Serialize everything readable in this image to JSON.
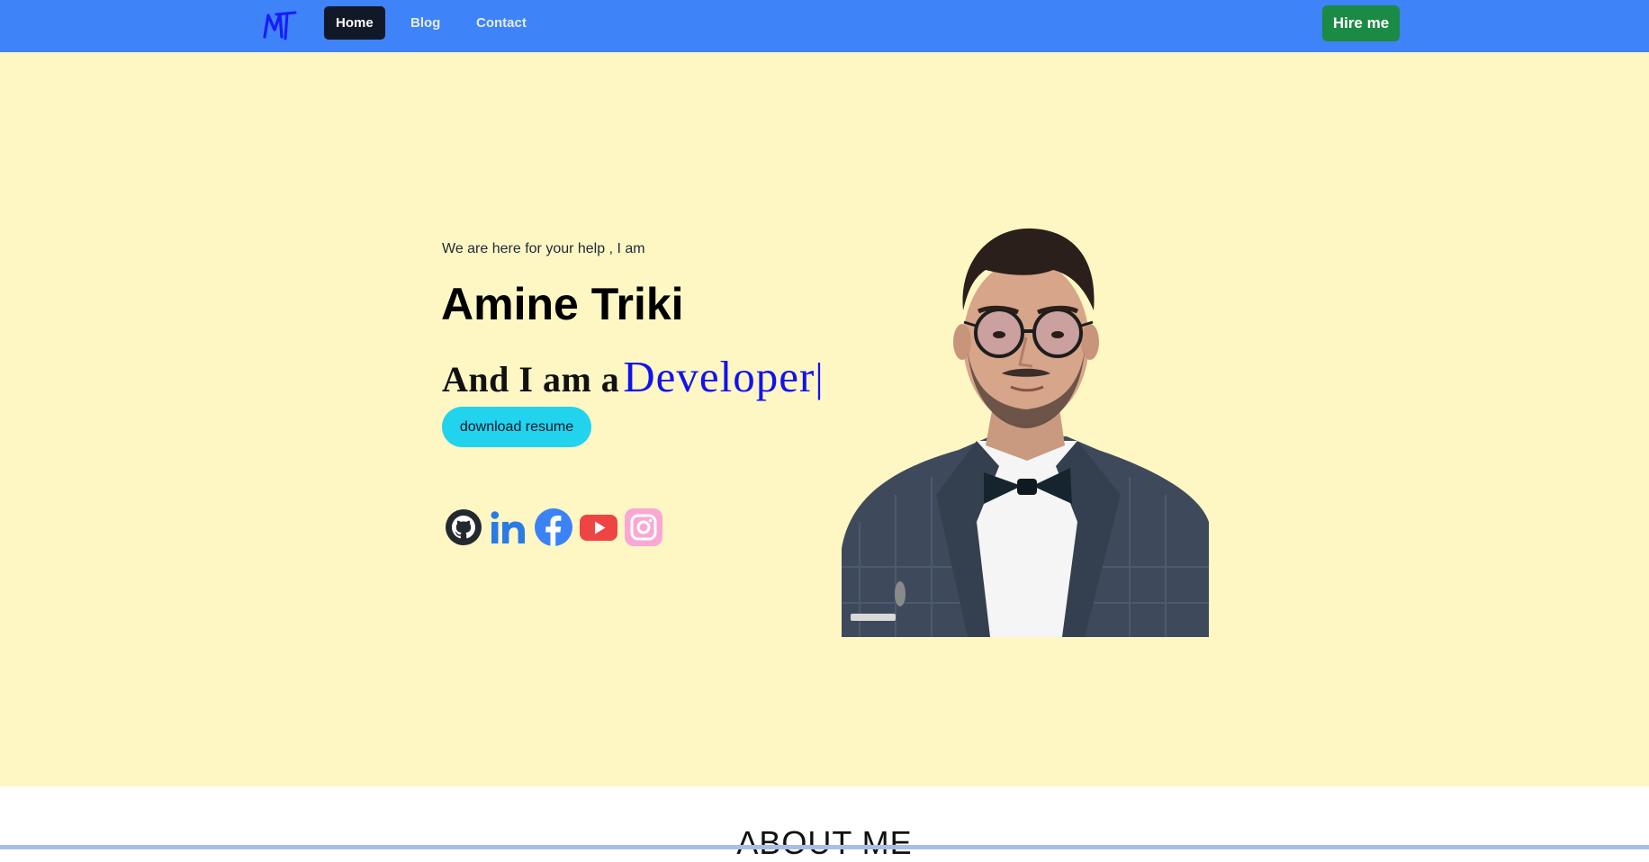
{
  "nav": {
    "links": [
      {
        "label": "Home",
        "active": true
      },
      {
        "label": "Blog",
        "active": false
      },
      {
        "label": "Contact",
        "active": false
      }
    ],
    "hire_label": "Hire me",
    "logo_text": "MT",
    "logo_color": "#1a1aff",
    "bar_color": "#3f83f8"
  },
  "hero": {
    "intro": "We are here for your help , I am",
    "name": "Amine Triki",
    "role_prefix": "And I am a",
    "role_word": "Developer",
    "role_cursor": "|",
    "resume_label": "download resume",
    "background": "#fef7c3",
    "socials": [
      {
        "name": "github-icon",
        "color": "#24292f"
      },
      {
        "name": "linkedin-icon",
        "color": "#2b7be4"
      },
      {
        "name": "facebook-icon",
        "color": "#3b82f6"
      },
      {
        "name": "youtube-icon",
        "color": "#ef4444"
      },
      {
        "name": "instagram-icon",
        "color": "#f9a8d4"
      }
    ]
  },
  "about": {
    "title": "ABOUT ME"
  }
}
